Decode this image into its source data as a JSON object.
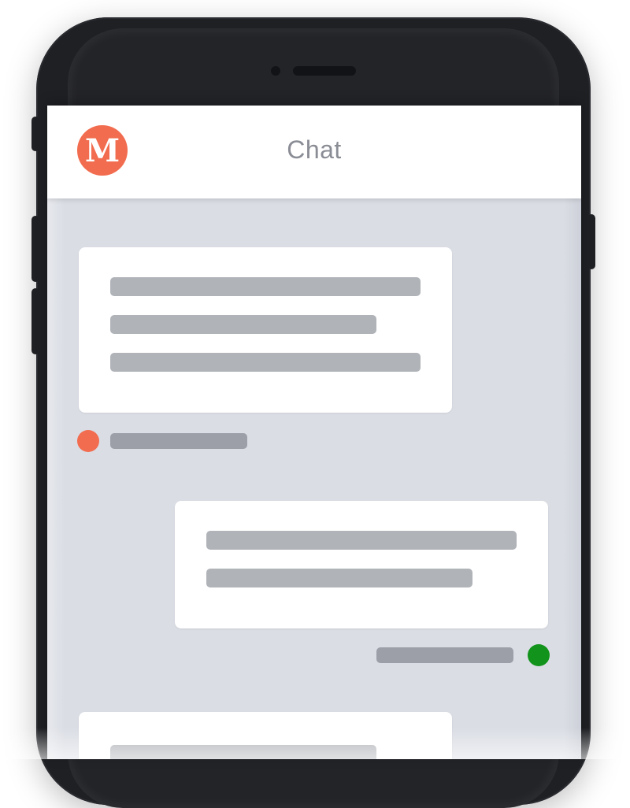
{
  "app": {
    "title": "Chat",
    "logo_letter": "M"
  },
  "colors": {
    "accent": "#f26c4f",
    "online": "#12931b",
    "screen_bg": "#dadde4",
    "placeholder": "#b0b3b8"
  },
  "messages": [
    {
      "side": "incoming",
      "lines": 3,
      "status_dot": "orange"
    },
    {
      "side": "outgoing",
      "lines": 2,
      "status_dot": "green"
    },
    {
      "side": "incoming",
      "lines": 1,
      "status_dot": ""
    }
  ]
}
